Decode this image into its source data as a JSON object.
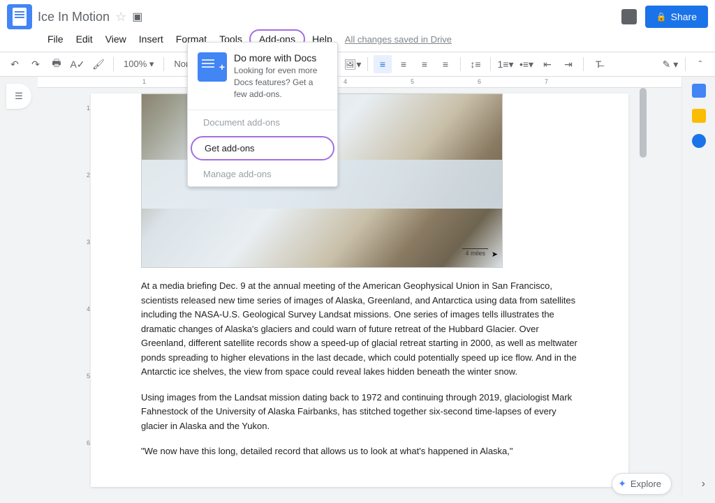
{
  "header": {
    "document_title": "Ice In Motion",
    "saved_status": "All changes saved in Drive",
    "share_label": "Share"
  },
  "menu": {
    "items": [
      "File",
      "Edit",
      "View",
      "Insert",
      "Format",
      "Tools",
      "Add-ons",
      "Help"
    ],
    "active_index": 6
  },
  "toolbar": {
    "zoom": "100%",
    "styles": "Normal text"
  },
  "dropdown": {
    "hero_title": "Do more with Docs",
    "hero_sub": "Looking for even more Docs features? Get a few add-ons.",
    "items": [
      {
        "label": "Document add-ons",
        "disabled": true
      },
      {
        "label": "Get add-ons",
        "highlighted": true
      },
      {
        "label": "Manage add-ons",
        "disabled": true
      }
    ]
  },
  "document": {
    "image_scale_label": "4 miles",
    "para1": "At a media briefing Dec. 9 at the annual meeting of the American Geophysical Union in San Francisco, scientists released new time series of images of Alaska, Greenland, and Antarctica using data from satellites including the NASA-U.S. Geological Survey Landsat missions. One series of images tells illustrates the dramatic changes of Alaska's glaciers and could warn of future retreat of the Hubbard Glacier. Over Greenland, different satellite records show a speed-up of glacial retreat starting in 2000, as well as meltwater ponds spreading to higher elevations in the last decade, which could potentially speed up ice flow. And in the Antarctic ice shelves, the view from space could reveal lakes hidden beneath the winter snow.",
    "para2": "Using images from the Landsat mission dating back to 1972 and continuing through 2019, glaciologist Mark Fahnestock of the University of Alaska Fairbanks, has stitched together six-second time-lapses of every glacier in Alaska and the Yukon.",
    "para3": "\"We now have this long, detailed record that allows us to look at what's happened in Alaska,\""
  },
  "explore_label": "Explore",
  "ruler_numbers": [
    1,
    2,
    3,
    4,
    5,
    6,
    7
  ]
}
